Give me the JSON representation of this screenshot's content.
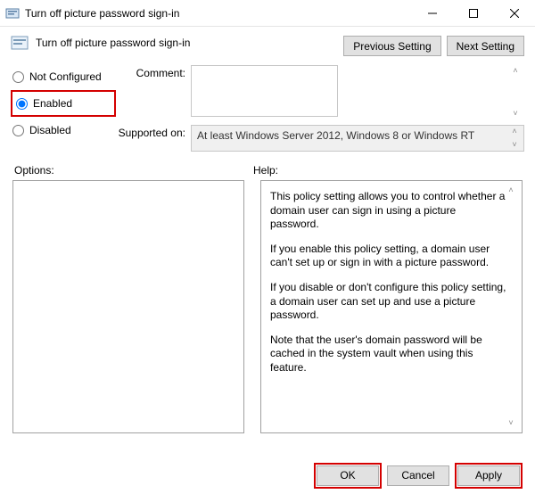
{
  "window": {
    "title": "Turn off picture password sign-in"
  },
  "header": {
    "title": "Turn off picture password sign-in",
    "prev_btn": "Previous Setting",
    "next_btn": "Next Setting"
  },
  "radios": {
    "not_configured": "Not Configured",
    "enabled": "Enabled",
    "disabled": "Disabled"
  },
  "fields": {
    "comment_label": "Comment:",
    "comment_value": "",
    "supported_label": "Supported on:",
    "supported_value": "At least Windows Server 2012, Windows 8 or Windows RT"
  },
  "section_labels": {
    "options": "Options:",
    "help": "Help:"
  },
  "help": {
    "p1": "This policy setting allows you to control whether a domain user can sign in using a picture password.",
    "p2": "If you enable this policy setting, a domain user can't set up or sign in with a picture password.",
    "p3": "If you disable or don't configure this policy setting, a domain user can set up and use a picture password.",
    "p4": "Note that the user's domain password will be cached in the system vault when using this feature."
  },
  "footer": {
    "ok": "OK",
    "cancel": "Cancel",
    "apply": "Apply"
  }
}
